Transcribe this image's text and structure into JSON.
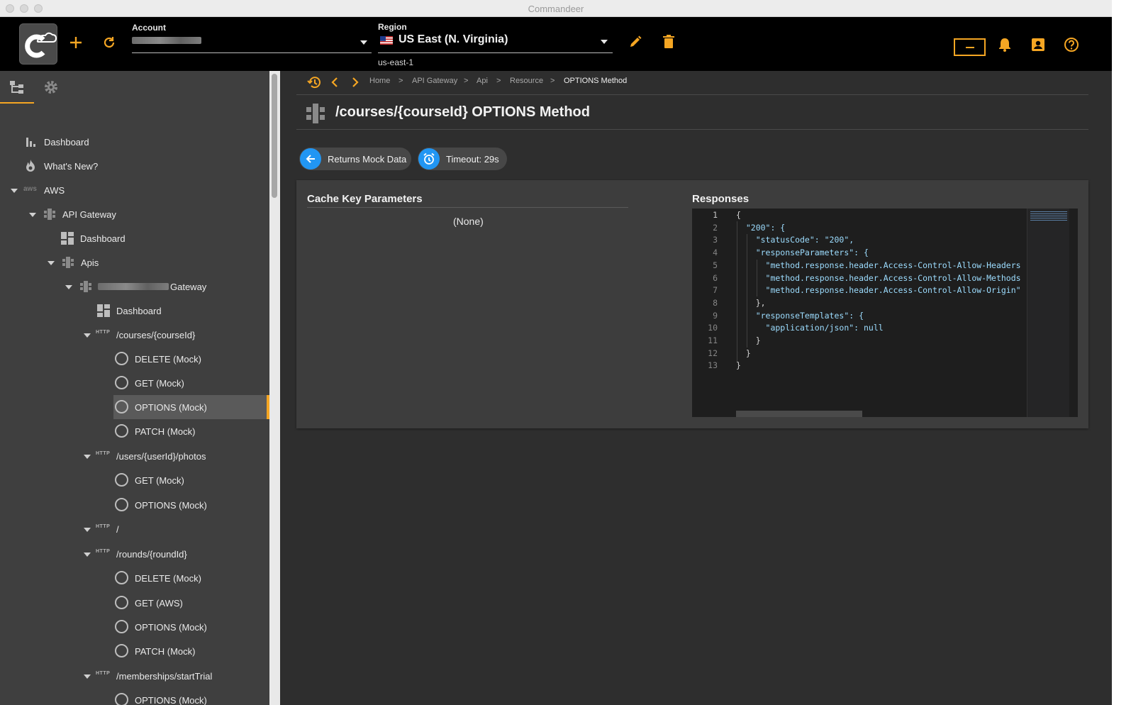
{
  "window": {
    "title": "Commandeer"
  },
  "header": {
    "account_label": "Account",
    "region_label": "Region",
    "region_value": "US East (N. Virginia)",
    "region_code": "us-east-1",
    "accent_color": "#f5a623"
  },
  "sidebar": {
    "tabs": [
      "tree-icon",
      "gear-icon"
    ],
    "items": [
      {
        "label": "Dashboard",
        "icon": "bar-chart-icon"
      },
      {
        "label": "What's New?",
        "icon": "flame-icon"
      },
      {
        "label": "AWS",
        "icon": "aws-logo"
      },
      {
        "label": "API Gateway",
        "icon": "api-gateway-icon"
      },
      {
        "label": "Dashboard",
        "icon": "dashboard-icon"
      },
      {
        "label": "Apis",
        "icon": "api-gateway-icon"
      },
      {
        "label": "Gateway",
        "icon": "api-gateway-icon"
      },
      {
        "label": "Dashboard",
        "icon": "dashboard-icon"
      },
      {
        "label": "/courses/{courseId}",
        "tag": "HTTP"
      },
      {
        "label": "DELETE (Mock)"
      },
      {
        "label": "GET (Mock)"
      },
      {
        "label": "OPTIONS (Mock)",
        "selected": true
      },
      {
        "label": "PATCH (Mock)"
      },
      {
        "label": "/users/{userId}/photos",
        "tag": "HTTP"
      },
      {
        "label": "GET (Mock)"
      },
      {
        "label": "OPTIONS (Mock)"
      },
      {
        "label": "/",
        "tag": "HTTP"
      },
      {
        "label": "/rounds/{roundId}",
        "tag": "HTTP"
      },
      {
        "label": "DELETE (Mock)"
      },
      {
        "label": "GET (AWS)"
      },
      {
        "label": "OPTIONS (Mock)"
      },
      {
        "label": "PATCH (Mock)"
      },
      {
        "label": "/memberships/startTrial",
        "tag": "HTTP"
      },
      {
        "label": "OPTIONS (Mock)"
      }
    ]
  },
  "breadcrumb": {
    "items": [
      "Home",
      "API Gateway",
      "Api",
      "Resource",
      "OPTIONS Method"
    ],
    "separator": ">"
  },
  "page": {
    "title": "/courses/{courseId} OPTIONS Method",
    "chips": [
      {
        "label": "Returns Mock Data",
        "icon": "arrow-left-icon"
      },
      {
        "label": "Timeout: 29s",
        "icon": "alarm-clock-icon"
      }
    ],
    "cache_key": {
      "title": "Cache Key Parameters",
      "value": "(None)"
    },
    "responses": {
      "title": "Responses",
      "line_numbers": [
        "1",
        "2",
        "3",
        "4",
        "5",
        "6",
        "7",
        "8",
        "9",
        "10",
        "11",
        "12",
        "13"
      ],
      "lines": [
        "{",
        "  \"200\": {",
        "    \"statusCode\": \"200\",",
        "    \"responseParameters\": {",
        "      \"method.response.header.Access-Control-Allow-Headers",
        "      \"method.response.header.Access-Control-Allow-Methods",
        "      \"method.response.header.Access-Control-Allow-Origin\"",
        "    },",
        "    \"responseTemplates\": {",
        "      \"application/json\": null",
        "    }",
        "  }",
        "}"
      ]
    }
  }
}
